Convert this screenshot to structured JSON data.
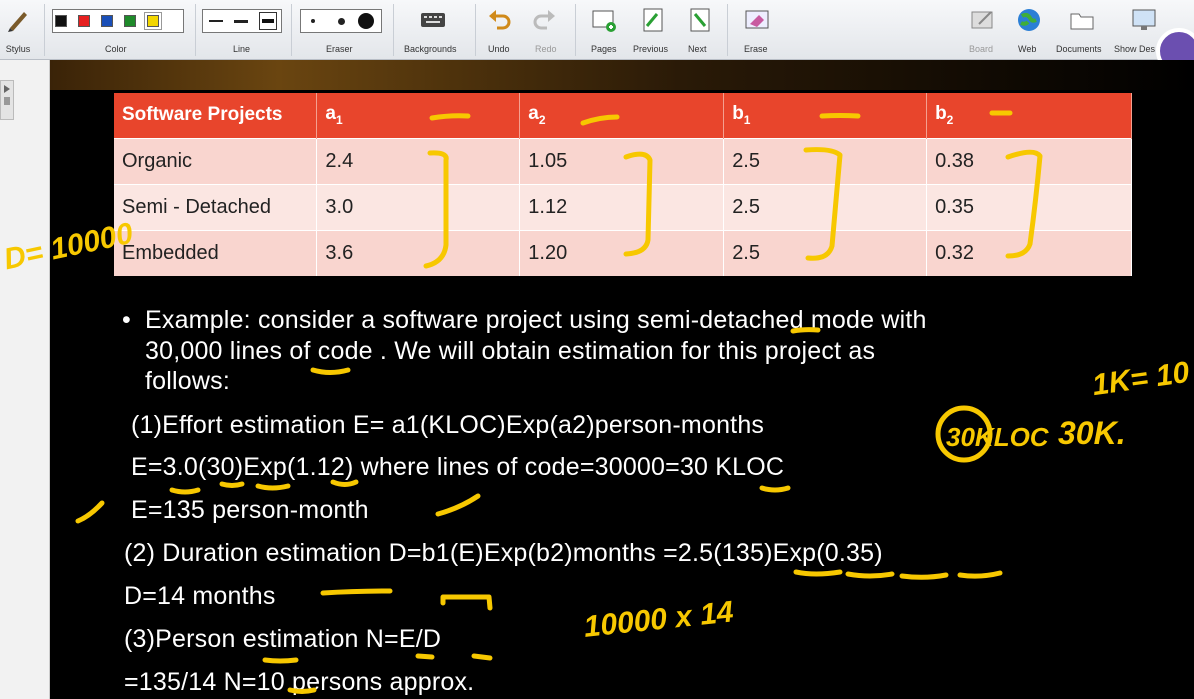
{
  "toolbar": {
    "stylus": "Stylus",
    "color": "Color",
    "line": "Line",
    "eraser": "Eraser",
    "backgrounds": "Backgrounds",
    "undo": "Undo",
    "redo": "Redo",
    "pages": "Pages",
    "previous": "Previous",
    "next": "Next",
    "erase": "Erase",
    "board": "Board",
    "web": "Web",
    "documents": "Documents",
    "show_desktop": "Show Des",
    "colors": [
      "#111111",
      "#e62020",
      "#1a4fb8",
      "#1f8a2a",
      "#f2d600"
    ]
  },
  "table": {
    "headers": [
      "Software Projects",
      "a",
      "a",
      "b",
      "b"
    ],
    "subs": [
      "",
      "1",
      "2",
      "1",
      "2"
    ],
    "rows": [
      [
        "Organic",
        "2.4",
        "1.05",
        "2.5",
        "0.38"
      ],
      [
        "Semi - Detached",
        "3.0",
        "1.12",
        "2.5",
        "0.35"
      ],
      [
        "Embedded",
        "3.6",
        "1.20",
        "2.5",
        "0.32"
      ]
    ]
  },
  "content": {
    "bullet": "•",
    "ex1": "Example: consider a software project using semi-detached mode with",
    "ex2": "30,000 lines of code . We will obtain estimation for this project as",
    "ex3": "follows:",
    "l1": "(1)Effort estimation E= a1(KLOC)Exp(a2)person-months",
    "l2": "E=3.0(30)Exp(1.12) where lines of code=30000=30 KLOC",
    "l3": "E=135 person-month",
    "l4": "(2) Duration estimation D=b1(E)Exp(b2)months =2.5(135)Exp(0.35)",
    "l5": "D=14 months",
    "l6": "(3)Person estimation N=E/D",
    "l7": "=135/14 N=10 persons approx."
  },
  "handwriting": {
    "d": "D= 10000",
    "k": "1K= 10",
    "kloc": "30KLOC",
    "k30": "30K.",
    "mult": "10000 x 14"
  }
}
